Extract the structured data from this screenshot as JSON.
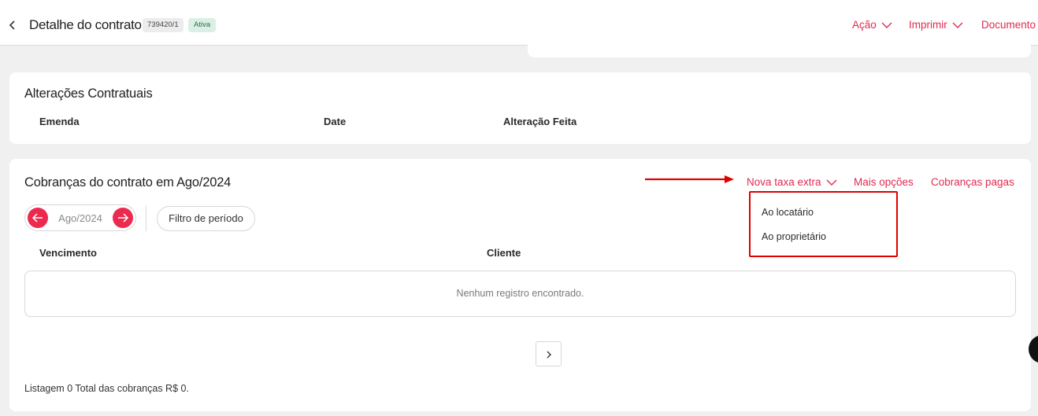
{
  "header": {
    "back_icon": "chevron-left-icon",
    "title": "Detalhe do contrato",
    "contract_id": "739420/1",
    "status": "Ativa",
    "actions": [
      {
        "label": "Ação",
        "icon": "chevron-down-icon"
      },
      {
        "label": "Imprimir",
        "icon": "chevron-down-icon"
      },
      {
        "label": "Documento"
      }
    ]
  },
  "alteracoes": {
    "title": "Alterações Contratuais",
    "columns": [
      "Emenda",
      "Date",
      "Alteração Feita"
    ]
  },
  "cobrancas": {
    "title": "Cobranças do contrato em Ago/2024",
    "nova_taxa_label": "Nova taxa extra",
    "mais_opcoes_label": "Mais opções",
    "cobrancas_pagas_label": "Cobranças pagas",
    "period": "Ago/2024",
    "prev_icon": "arrow-left-icon",
    "next_icon": "arrow-right-icon",
    "filter_label": "Filtro de período",
    "columns": [
      "Vencimento",
      "Cliente"
    ],
    "empty_message": "Nenhum registro encontrado.",
    "pagination_icon": "chevron-right-icon",
    "footer": "Listagem 0 Total das cobranças R$ 0."
  },
  "dropdown": {
    "items": [
      "Ao locatário",
      "Ao proprietário"
    ]
  },
  "colors": {
    "accent": "#e2294f",
    "annotation": "#e00000"
  }
}
